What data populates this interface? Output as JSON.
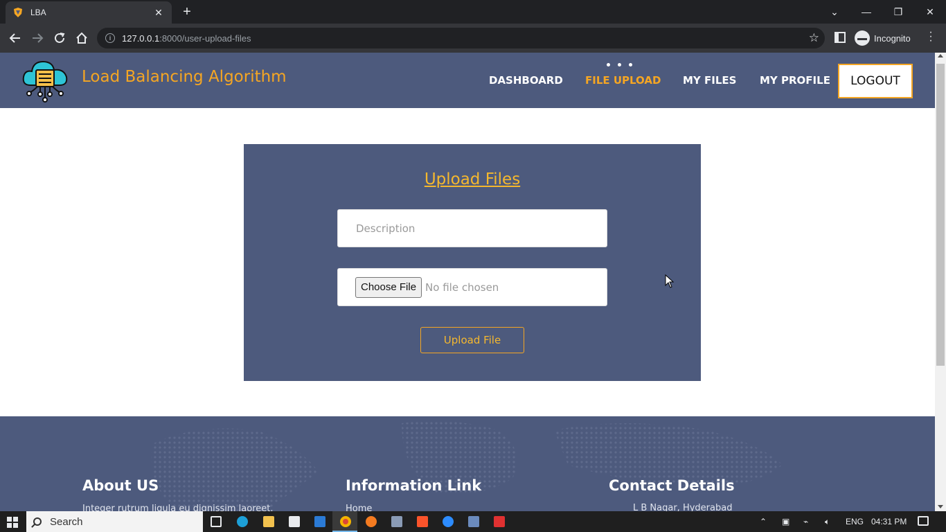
{
  "browser": {
    "tab_title": "LBA",
    "url_host": "127.0.0.1",
    "url_path": ":8000/user-upload-files",
    "profile_label": "Incognito"
  },
  "site": {
    "brand": "Load Balancing Algorithm",
    "nav": [
      "DASHBOARD",
      "FILE UPLOAD",
      "MY FILES",
      "MY PROFILE"
    ],
    "active_nav": "FILE UPLOAD",
    "logout": "LOGOUT"
  },
  "upload": {
    "title": "Upload Files",
    "description_placeholder": "Description",
    "choose_file_label": "Choose File",
    "no_file_text": "No file chosen",
    "submit_label": "Upload File"
  },
  "footer": {
    "about_title": "About US",
    "about_text": "Integer rutrum ligula eu dignissim laoreet.",
    "info_title": "Information Link",
    "info_first_link": "Home",
    "contact_title": "Contact Details",
    "contact_address": "L B Nagar, Hyderabad"
  },
  "taskbar": {
    "search_label": "Search",
    "language": "ENG",
    "time": "04:31 PM"
  },
  "colors": {
    "primary": "#4d5a7d",
    "accent": "#f5a623"
  }
}
